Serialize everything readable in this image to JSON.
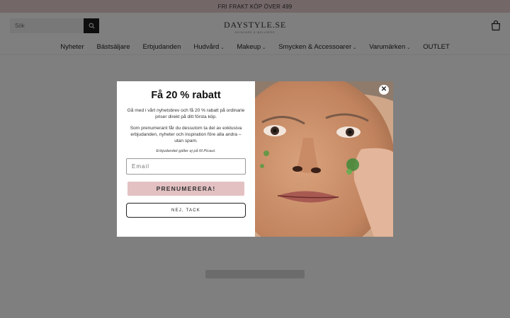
{
  "announcement": "FRI FRAKT KÖP ÖVER 499",
  "search": {
    "placeholder": "Sök",
    "icon": "search-icon"
  },
  "logo": {
    "name": "DAYSTYLE.SE",
    "tagline": "SKINCARE & WELLNESS"
  },
  "cart_icon": "bag-icon",
  "nav": [
    {
      "label": "Nyheter",
      "dropdown": false
    },
    {
      "label": "Bästsäljare",
      "dropdown": false
    },
    {
      "label": "Erbjudanden",
      "dropdown": false
    },
    {
      "label": "Hudvård",
      "dropdown": true
    },
    {
      "label": "Makeup",
      "dropdown": true
    },
    {
      "label": "Smycken & Accessoarer",
      "dropdown": true
    },
    {
      "label": "Varumärken",
      "dropdown": true
    },
    {
      "label": "OUTLET",
      "dropdown": false
    }
  ],
  "popup": {
    "title": "Få 20 % rabatt",
    "text1": "Gå med i vårt nyhetsbrev och få 20 % rabatt på ordinarie priser direkt på ditt första köp.",
    "text2": "Som prenumerant får du dessutom ta del av exklusiva erbjudanden, nyheter och inspiration före alla andra – utan spam.",
    "disclaimer": "Erbjudandet gäller ej på M.Picaut.",
    "email_placeholder": "Email",
    "subscribe_label": "PRENUMERERA!",
    "decline_label": "NEJ, TACK",
    "close_symbol": "✕"
  },
  "colors": {
    "announcement_bg": "#e8cfd1",
    "subscribe_bg": "#e3c1c2",
    "overlay": "rgba(0,0,0,0.5)"
  }
}
